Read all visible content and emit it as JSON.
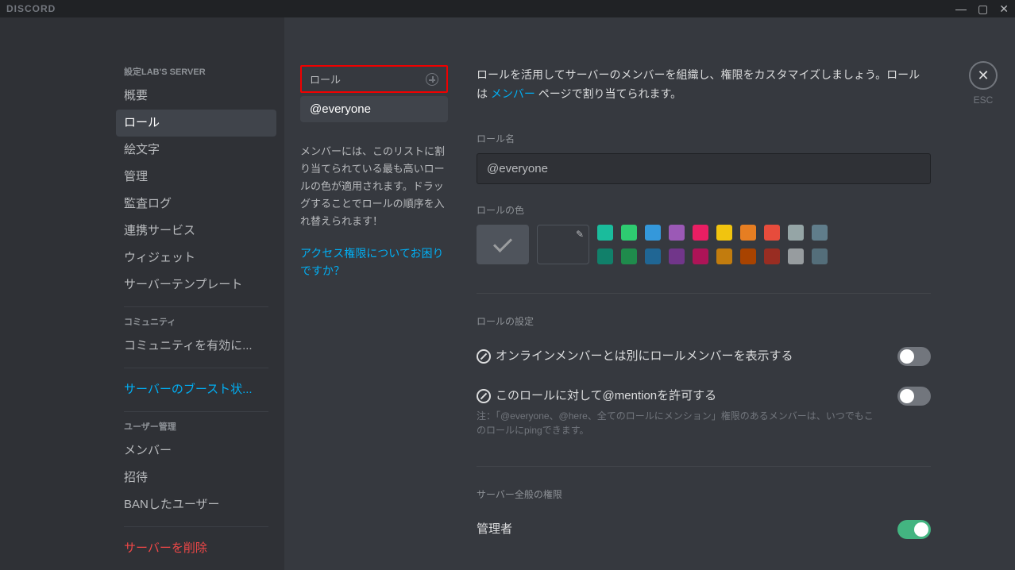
{
  "app": {
    "logo": "DISCORD"
  },
  "window_buttons": {
    "min": "—",
    "max": "▢",
    "close": "✕"
  },
  "sidebar": {
    "heading1": "設定LAB'S SERVER",
    "items1": [
      "概要",
      "ロール",
      "絵文字",
      "管理",
      "監査ログ",
      "連携サービス",
      "ウィジェット",
      "サーバーテンプレート"
    ],
    "heading2": "コミュニティ",
    "items2": [
      "コミュニティを有効に..."
    ],
    "boost": "サーバーのブースト状...",
    "heading3": "ユーザー管理",
    "items3": [
      "メンバー",
      "招待",
      "BANしたユーザー"
    ],
    "delete": "サーバーを削除"
  },
  "roles": {
    "header_label": "ロール",
    "everyone": "@everyone",
    "hint": "メンバーには、このリストに割り当てられている最も高いロールの色が適用されます。ドラッグすることでロールの順序を入れ替えられます！",
    "help": "アクセス権限についてお困りですか？"
  },
  "main": {
    "intro_pre": "ロールを活用してサーバーのメンバーを組織し、権限をカスタマイズしましょう。ロールは ",
    "intro_link": "メンバー",
    "intro_post": " ページで割り当てられます。",
    "name_label": "ロール名",
    "name_value": "@everyone",
    "color_label": "ロールの色",
    "colors_row1": [
      "#1abc9c",
      "#2ecc71",
      "#3498db",
      "#9b59b6",
      "#e91e63",
      "#f1c40f",
      "#e67e22",
      "#e74c3c",
      "#95a5a6",
      "#607d8b"
    ],
    "colors_row2": [
      "#11806a",
      "#1f8b4c",
      "#206694",
      "#71368a",
      "#ad1457",
      "#c27c0e",
      "#a84300",
      "#992d22",
      "#979c9f",
      "#546e7a"
    ],
    "settings_label": "ロールの設定",
    "setting1": "オンラインメンバーとは別にロールメンバーを表示する",
    "setting2": "このロールに対して@mentionを許可する",
    "setting2_note": "注：「@everyone、@here、全てのロールにメンション」権限のあるメンバーは、いつでもこのロールにpingできます。",
    "perms_label": "サーバー全般の権限",
    "perm1": "管理者"
  },
  "esc": {
    "x": "✕",
    "label": "ESC"
  }
}
